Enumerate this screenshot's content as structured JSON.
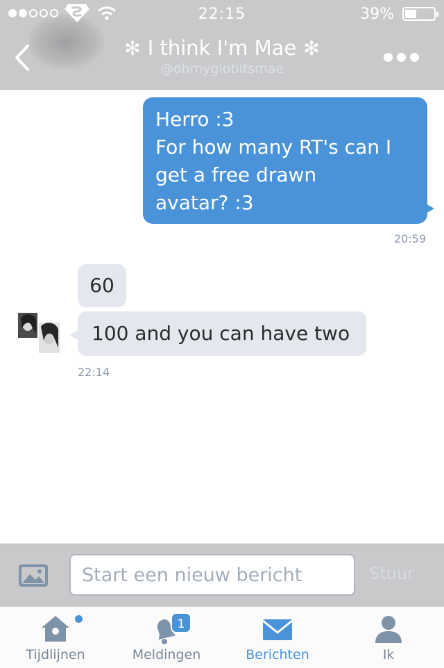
{
  "status_bar": {
    "time": "22:15",
    "battery": "39%",
    "signal_dots_filled": 2,
    "signal_dots_total": 5
  },
  "header": {
    "title_prefix": "✻",
    "title": "I think I'm Mae",
    "title_suffix": "✻",
    "handle": "@ohmyglobitsmae"
  },
  "messages": {
    "outgoing": {
      "lines": [
        "Herro :3",
        "For how many RT's can I",
        "get a free drawn",
        "avatar? :3"
      ],
      "time": "20:59"
    },
    "incoming": {
      "bubble_1": "60",
      "bubble_2": "100 and you can have two",
      "time": "22:14"
    }
  },
  "composer": {
    "placeholder": "Start een nieuw bericht",
    "send_label": "Stuur"
  },
  "tabs": [
    {
      "label": "Tijdlijnen",
      "icon": "home-icon"
    },
    {
      "label": "Meldingen",
      "icon": "bell-icon",
      "badge": "1"
    },
    {
      "label": "Berichten",
      "icon": "envelope-icon",
      "active": true
    },
    {
      "label": "Ik",
      "icon": "person-icon"
    }
  ],
  "colors": {
    "accent": "#4a93d9",
    "bar_gray": "#c9c9cb",
    "incoming_bubble": "#e4e8ee"
  }
}
